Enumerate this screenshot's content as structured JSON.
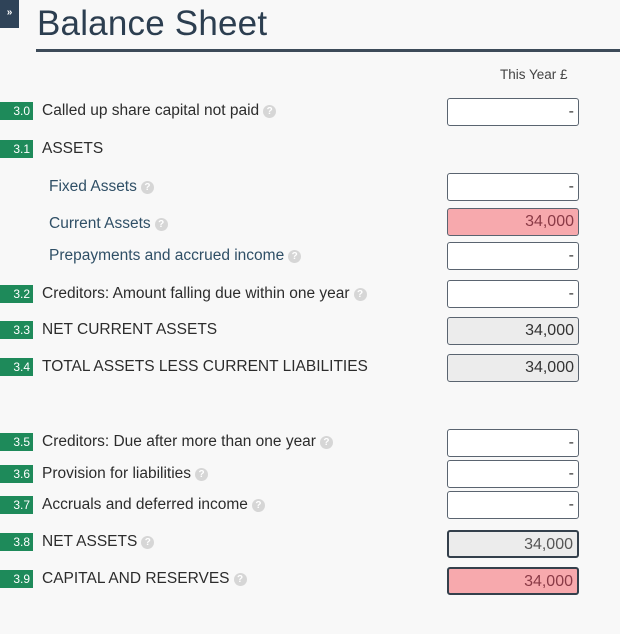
{
  "sidebar_toggle": {
    "icon": "double-chevron-right-icon",
    "glyph": "»"
  },
  "page": {
    "title": "Balance Sheet",
    "column_header": "This Year £"
  },
  "help_glyph": "?",
  "rows": [
    {
      "num": "3.0",
      "label": "Called up share capital not paid",
      "help": true,
      "value": "-",
      "style": "input"
    },
    {
      "num": "3.1",
      "label": "ASSETS",
      "help": false,
      "value": null,
      "style": "heading"
    },
    {
      "num": null,
      "label": "Fixed Assets",
      "help": true,
      "value": "-",
      "style": "input"
    },
    {
      "num": null,
      "label": "Current Assets",
      "help": true,
      "value": "34,000",
      "style": "error"
    },
    {
      "num": null,
      "label": "Prepayments and accrued income",
      "help": true,
      "value": "-",
      "style": "input"
    },
    {
      "num": "3.2",
      "label": "Creditors: Amount falling due within one year",
      "help": true,
      "value": "-",
      "style": "input"
    },
    {
      "num": "3.3",
      "label": "NET CURRENT ASSETS",
      "help": false,
      "value": "34,000",
      "style": "calculated"
    },
    {
      "num": "3.4",
      "label": "TOTAL ASSETS LESS CURRENT LIABILITIES",
      "help": false,
      "value": "34,000",
      "style": "calculated"
    },
    {
      "num": "3.5",
      "label": "Creditors: Due after more than one year",
      "help": true,
      "value": "-",
      "style": "input"
    },
    {
      "num": "3.6",
      "label": "Provision for liabilities",
      "help": true,
      "value": "-",
      "style": "input"
    },
    {
      "num": "3.7",
      "label": "Accruals and deferred income",
      "help": true,
      "value": "-",
      "style": "input"
    },
    {
      "num": "3.8",
      "label": "NET ASSETS",
      "help": true,
      "value": "34,000",
      "style": "total"
    },
    {
      "num": "3.9",
      "label": "CAPITAL AND RESERVES",
      "help": true,
      "value": "34,000",
      "style": "total-error"
    }
  ],
  "colors": {
    "badge": "#1e8a5a",
    "error_fill": "#f7a9ad",
    "calculated_fill": "#ececec",
    "title": "#2c3e50"
  }
}
